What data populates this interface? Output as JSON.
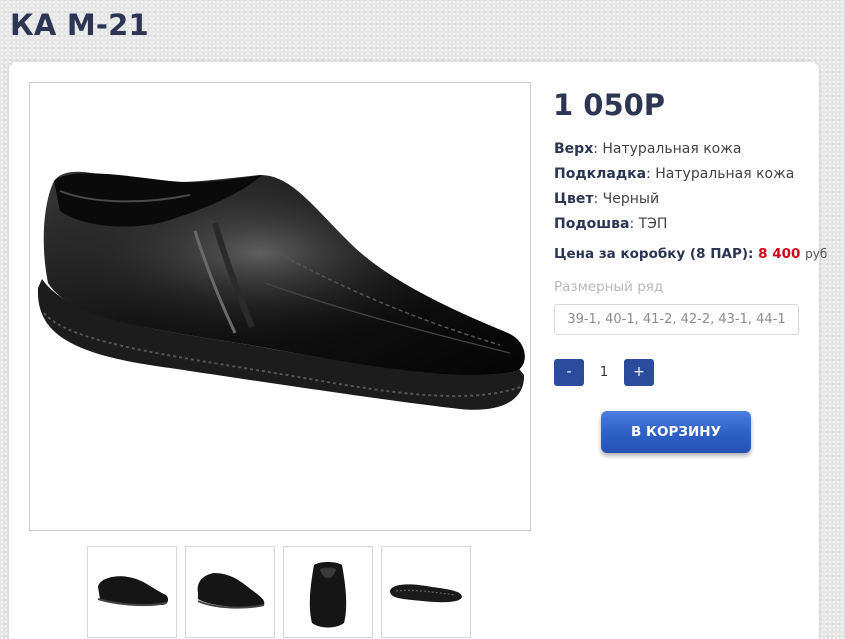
{
  "product": {
    "title": "КА М-21",
    "price": "1 050Р"
  },
  "specs": [
    {
      "label": "Верх",
      "value": ": Натуральная кожа"
    },
    {
      "label": "Подкладка",
      "value": ": Натуральная кожа"
    },
    {
      "label": "Цвет",
      "value": ": Черный"
    },
    {
      "label": "Подошва",
      "value": ": ТЭП"
    }
  ],
  "box_price": {
    "label": "Цена за коробку (8 ПАР):",
    "amount": "8 400",
    "unit": "руб"
  },
  "sizes": {
    "label": "Размерный ряд",
    "value": "39-1, 40-1, 41-2, 42-2, 43-1, 44-1"
  },
  "quantity": {
    "minus": "-",
    "value": "1",
    "plus": "+"
  },
  "cart_button": "В КОРЗИНУ",
  "colors": {
    "accent": "#2b4b9c",
    "price_red": "#d0021b",
    "title": "#2c3552"
  },
  "images": {
    "main": "black-leather-slip-on-shoe",
    "thumbnails": [
      "shoe-side-view",
      "shoe-three-quarter-view",
      "shoe-front-view",
      "shoe-sole-view"
    ]
  }
}
